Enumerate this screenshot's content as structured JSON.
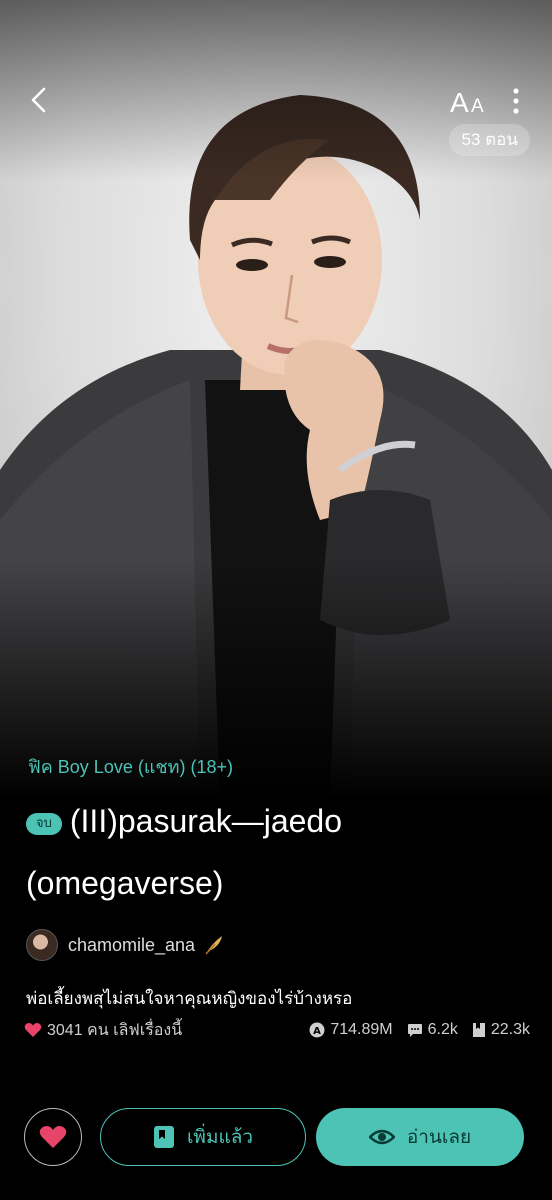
{
  "header": {
    "episode_count": "53 ตอน",
    "font_label": "AA"
  },
  "story": {
    "genre": "ฟิค Boy Love (แชท) (18+)",
    "status_badge": "จบ",
    "title": "(III)pasurak—jaedo (omegaverse)",
    "author": "chamomile_ana",
    "description": "พ่อเลี้ยงพสุไม่สนใจหาคุณหญิงของไร่บ้างหรอ",
    "stats": {
      "likes": "3041 คน เลิฟเรื่องนี้",
      "views": "714.89M",
      "comments": "6.2k",
      "favorites": "22.3k"
    }
  },
  "actions": {
    "added_label": "เพิ่มแล้ว",
    "read_label": "อ่านเลย"
  },
  "colors": {
    "accent": "#4cc3b5",
    "like": "#e8446a",
    "background": "#000000"
  }
}
